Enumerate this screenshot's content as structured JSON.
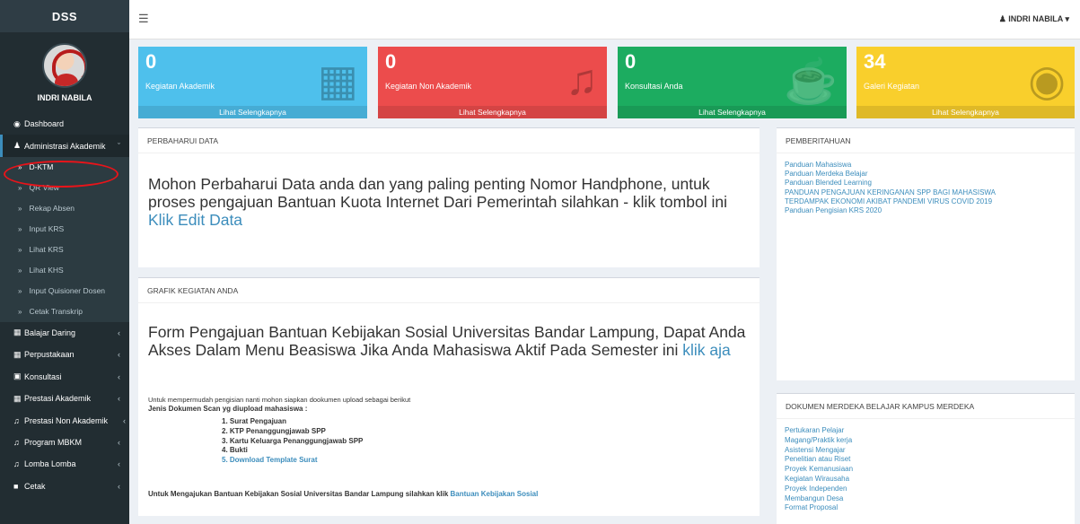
{
  "sidebar": {
    "brand": "DSS",
    "user_name": "INDRI NABILA",
    "items": [
      {
        "label": "Dashboard",
        "icon": "dashboard-icon"
      },
      {
        "label": "Administrasi Akademik",
        "icon": "user-icon"
      },
      {
        "label": "Balajar Daring",
        "icon": "book-icon"
      },
      {
        "label": "Perpustakaan",
        "icon": "book-icon"
      },
      {
        "label": "Konsultasi",
        "icon": "chat-icon"
      },
      {
        "label": "Prestasi Akademik",
        "icon": "book-icon"
      },
      {
        "label": "Prestasi Non Akademik",
        "icon": "music-icon"
      },
      {
        "label": "Program MBKM",
        "icon": "music-icon"
      },
      {
        "label": "Lomba Lomba",
        "icon": "music-icon"
      },
      {
        "label": "Cetak",
        "icon": "file-icon"
      }
    ],
    "submenu": [
      "D-KTM",
      "QR View",
      "Rekap Absen",
      "Input KRS",
      "Lihat KRS",
      "Lihat KHS",
      "Input Quisioner Dosen",
      "Cetak Transkrip"
    ]
  },
  "topbar": {
    "user": "INDRI NABILA"
  },
  "boxes": [
    {
      "number": "0",
      "label": "Kegiatan Akademik",
      "footer": "Lihat Selengkapnya",
      "icon": "book-icon"
    },
    {
      "number": "0",
      "label": "Kegiatan Non Akademik",
      "footer": "Lihat Selengkapnya",
      "icon": "music-icon"
    },
    {
      "number": "0",
      "label": "Konsultasi Anda",
      "footer": "Lihat Selengkapnya",
      "icon": "coffee-icon"
    },
    {
      "number": "34",
      "label": "Galeri Kegiatan",
      "footer": "Lihat Selengkapnya",
      "icon": "camera-icon"
    }
  ],
  "update_panel": {
    "title": "PERBAHARUI DATA",
    "text": "Mohon Perbaharui Data anda dan yang paling penting Nomor Handphone, untuk proses pengajuan Bantuan Kuota Internet Dari Pemerintah silahkan - klik tombol ini ",
    "link": "Klik Edit Data"
  },
  "grafik_panel": {
    "title": "GRAFIK KEGIATAN ANDA",
    "text": "Form Pengajuan Bantuan Kebijakan Sosial Universitas Bandar Lampung, Dapat Anda Akses Dalam Menu Beasiswa Jika Anda Mahasiswa Aktif Pada Semester ini ",
    "link": "klik aja",
    "note": "Untuk mempermudah pengisian nanti mohon siapkan dookumen upload sebagai berikut",
    "doc_heading": "Jenis Dokumen Scan yg diupload mahasiswa :",
    "docs": [
      "1. Surat Pengajuan",
      "2. KTP Penanggungjawab SPP",
      "3. Kartu Keluarga Penanggungjawab SPP",
      "4. Bukti",
      "5. Download Template Surat"
    ],
    "final_text": "Untuk Mengajukan Bantuan Kebijakan Sosial Universitas Bandar Lampung silahkan klik ",
    "final_link": "Bantuan Kebijakan Sosial"
  },
  "notice_panel": {
    "title": "PEMBERITAHUAN",
    "links": [
      "Panduan Mahasiswa",
      "Panduan Merdeka Belajar",
      "Panduan Blended Learning",
      "PANDUAN PENGAJUAN KERINGANAN SPP BAGI MAHASISWA",
      "TERDAMPAK EKONOMI AKIBAT PANDEMI VIRUS COVID 2019",
      "Panduan Pengisian KRS 2020"
    ]
  },
  "mbkm_panel": {
    "title": "DOKUMEN MERDEKA BELAJAR KAMPUS MERDEKA",
    "links": [
      "Pertukaran Pelajar",
      "Magang/Praktik kerja",
      "Asistensi Mengajar",
      "Penelitian atau Riset",
      "Proyek Kemanusiaan",
      "Kegiatan Wirausaha",
      "Proyek Independen",
      "Membangun Desa",
      "Format Proposal"
    ]
  }
}
